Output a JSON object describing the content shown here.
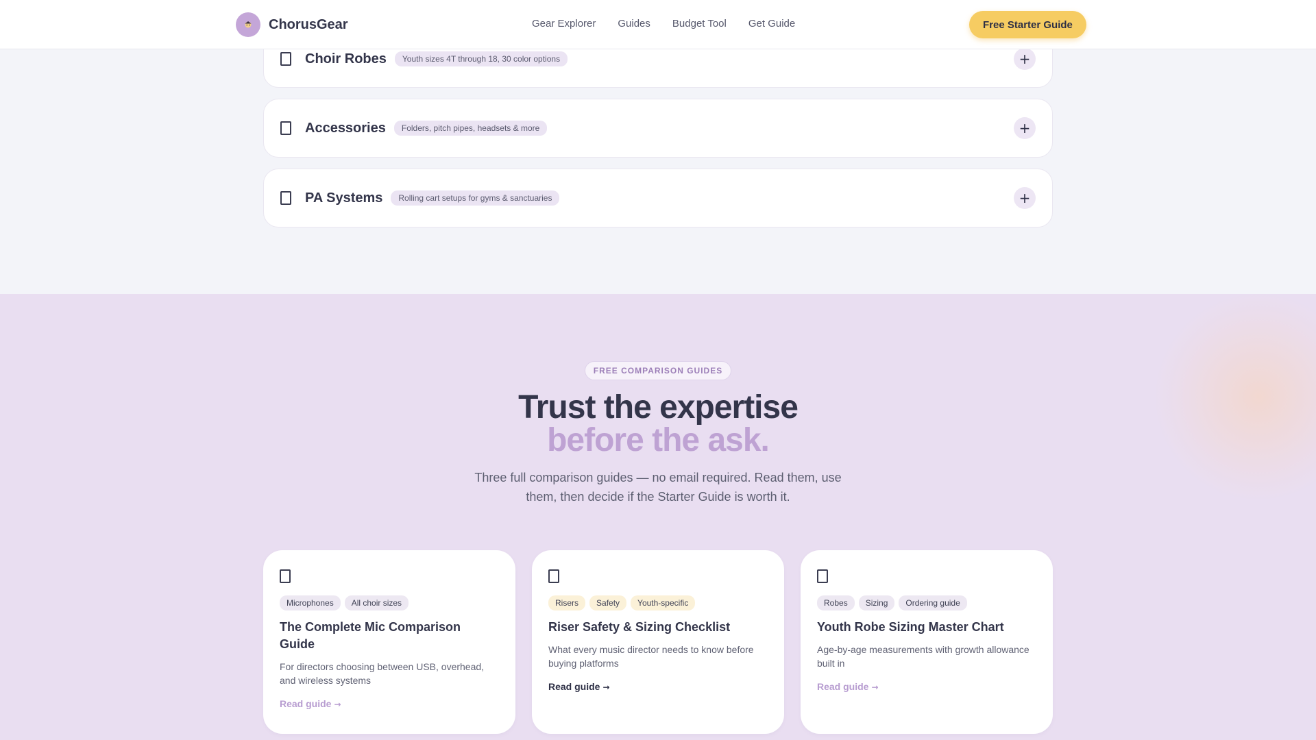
{
  "nav": {
    "brand": "ChorusGear",
    "links": [
      "Gear Explorer",
      "Guides",
      "Budget Tool",
      "Get Guide"
    ],
    "cta": "Free Starter Guide",
    "logo_icon": "choir-singer-icon"
  },
  "accordion": {
    "items": [
      {
        "title": "Choir Robes",
        "tag": "Youth sizes 4T through 18, 30 color options"
      },
      {
        "title": "Accessories",
        "tag": "Folders, pitch pipes, headsets & more"
      },
      {
        "title": "PA Systems",
        "tag": "Rolling cart setups for gyms & sanctuaries"
      }
    ],
    "toggle_symbol": "+"
  },
  "guides": {
    "eyebrow": "FREE COMPARISON GUIDES",
    "heading_line1": "Trust the expertise",
    "heading_line2": "before the ask.",
    "subtitle": "Three full comparison guides — no email required. Read them, use them, then decide if the Starter Guide is worth it.",
    "cards": [
      {
        "tags": [
          "Microphones",
          "All choir sizes"
        ],
        "title": "The Complete Mic Comparison Guide",
        "description": "For directors choosing between USB, overhead, and wireless systems",
        "link": "Read guide",
        "arrow": "→"
      },
      {
        "tags": [
          "Risers",
          "Safety",
          "Youth-specific"
        ],
        "title": "Riser Safety & Sizing Checklist",
        "description": "What every music director needs to know before buying platforms",
        "link": "Read guide",
        "arrow": "→"
      },
      {
        "tags": [
          "Robes",
          "Sizing",
          "Ordering guide"
        ],
        "title": "Youth Robe Sizing Master Chart",
        "description": "Age-by-age measurements with growth allowance built in",
        "link": "Read guide",
        "arrow": "→"
      }
    ]
  },
  "colors": {
    "accent_purple": "#bea2d3",
    "cta_yellow": "#f6cc62",
    "text_dark": "#33354a",
    "section_bg": "#e9def1"
  }
}
